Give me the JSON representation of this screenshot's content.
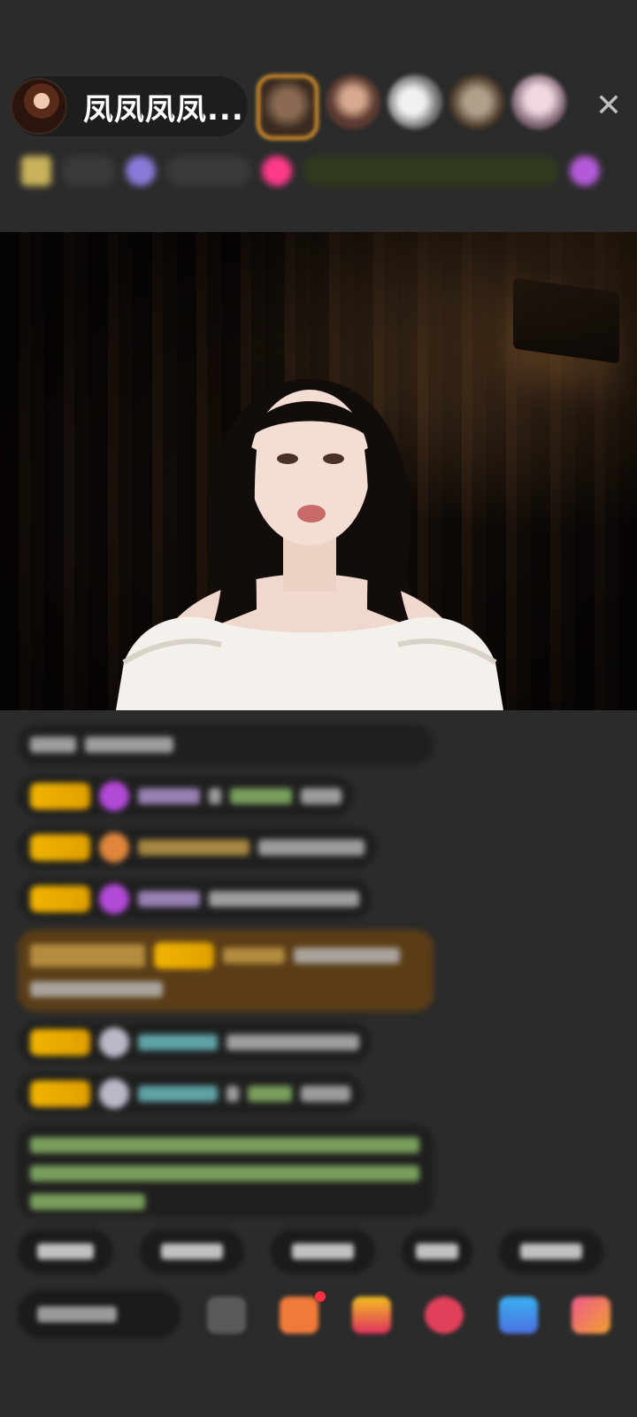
{
  "host": {
    "name": "凤凤凤凤...",
    "avatar_icon": "host-avatar"
  },
  "viewers": [
    {
      "icon": "viewer-avatar-1",
      "color": "#e39a2e"
    },
    {
      "icon": "viewer-avatar-2",
      "color": "#8a5a4a"
    },
    {
      "icon": "viewer-avatar-3",
      "color": "#d9d9d9"
    },
    {
      "icon": "viewer-avatar-4",
      "color": "#7a6a50"
    },
    {
      "icon": "viewer-avatar-5",
      "color": "#c8a8b8"
    }
  ],
  "close_icon": "close-icon",
  "colors": {
    "background": "#2b2b2b",
    "badge_gold": "#f2b400",
    "highlight_message": "#5a3d17",
    "accent_pink": "#ff3a8a"
  }
}
